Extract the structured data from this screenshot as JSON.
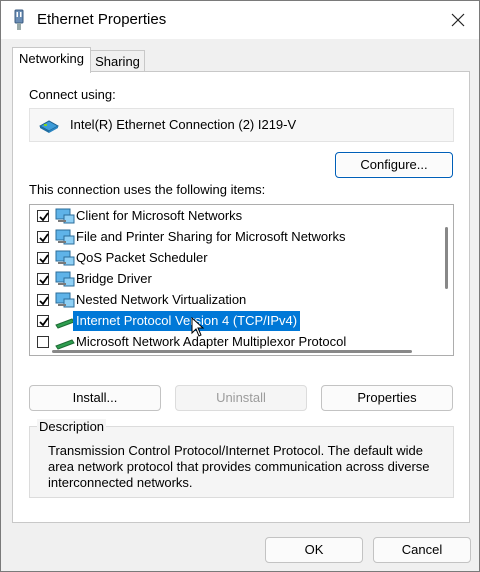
{
  "window": {
    "title": "Ethernet Properties",
    "icon": "network-adapter-icon",
    "close_icon": "close-icon"
  },
  "tabs": [
    {
      "label": "Networking",
      "active": true
    },
    {
      "label": "Sharing",
      "active": false
    }
  ],
  "networking": {
    "connect_using_label": "Connect using:",
    "adapter_name": "Intel(R) Ethernet Connection (2) I219-V",
    "configure_label": "Configure...",
    "items_label": "This connection uses the following items:",
    "items": [
      {
        "label": "Client for Microsoft Networks",
        "checked": true,
        "icon": "network-client-icon"
      },
      {
        "label": "File and Printer Sharing for Microsoft Networks",
        "checked": true,
        "icon": "network-service-icon"
      },
      {
        "label": "QoS Packet Scheduler",
        "checked": true,
        "icon": "network-service-icon"
      },
      {
        "label": "Bridge Driver",
        "checked": true,
        "icon": "network-protocol-icon"
      },
      {
        "label": "Nested Network Virtualization",
        "checked": true,
        "icon": "network-protocol-icon"
      },
      {
        "label": "Internet Protocol Version 4 (TCP/IPv4)",
        "checked": true,
        "selected": true,
        "icon": "protocol-icon"
      },
      {
        "label": "Microsoft Network Adapter Multiplexor Protocol",
        "checked": false,
        "icon": "protocol-icon"
      }
    ],
    "install_label": "Install...",
    "uninstall_label": "Uninstall",
    "properties_label": "Properties",
    "description_legend": "Description",
    "description_text": "Transmission Control Protocol/Internet Protocol. The default wide area network protocol that provides communication across diverse interconnected networks."
  },
  "footer": {
    "ok_label": "OK",
    "cancel_label": "Cancel"
  },
  "colors": {
    "selection": "#0078d7",
    "accent_border": "#005fb8"
  }
}
